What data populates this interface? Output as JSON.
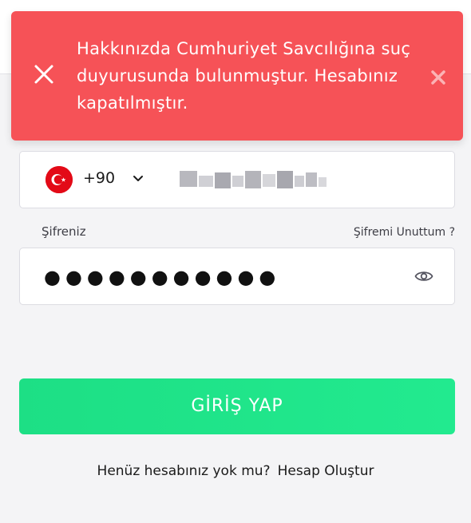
{
  "toast": {
    "message": "Hakkınızda Cumhuriyet Savcılığına suç duyurusunda bulunmuştur. Hesabınız kapatılmıştır.",
    "background_color": "#f65257",
    "lead_icon": "close-icon",
    "dismiss_icon": "close-icon"
  },
  "phone": {
    "country_flag": "turkey-flag-icon",
    "dial_code": "+90",
    "chevron_icon": "chevron-down-icon",
    "number_masked": true
  },
  "password": {
    "label": "Şifreniz",
    "forgot_label": "Şifremi Unuttum ?",
    "value_masked": "●●●●●●●●●●●",
    "reveal_icon": "eye-icon"
  },
  "login_button": {
    "label": "GİRİŞ YAP",
    "color": "#22e48b"
  },
  "register": {
    "question": "Henüz hesabınız yok mu?",
    "link_label": "Hesap Oluştur"
  }
}
